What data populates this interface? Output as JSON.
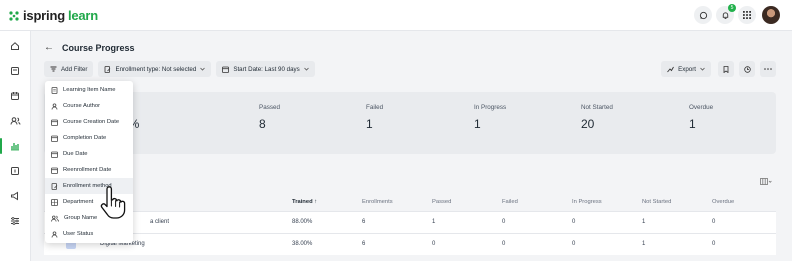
{
  "app": {
    "logo_word1": "ispring",
    "logo_word2": "learn",
    "notification_count": "5",
    "brand_color": "#20a84a"
  },
  "page": {
    "title": "Course Progress"
  },
  "toolbar": {
    "add_filter": "Add Filter",
    "enrollment_type": "Enrollment type: Not selected",
    "start_date": "Start Date: Last 90 days",
    "export": "Export"
  },
  "stats": [
    {
      "label": "ned",
      "value": "5%"
    },
    {
      "label": "Passed",
      "value": "8"
    },
    {
      "label": "Failed",
      "value": "1"
    },
    {
      "label": "In Progress",
      "value": "1"
    },
    {
      "label": "Not Started",
      "value": "20"
    },
    {
      "label": "Overdue",
      "value": "1"
    }
  ],
  "table": {
    "columns": [
      "Trained",
      "Enrollments",
      "Passed",
      "Failed",
      "In Progress",
      "Not Started",
      "Overdue"
    ],
    "rows": [
      {
        "name": "a client",
        "trained": "88.00%",
        "enrollments": "6",
        "passed": "1",
        "failed": "0",
        "in_progress": "0",
        "not_started": "1",
        "overdue": "0"
      },
      {
        "name": "Digital Marketing",
        "trained": "38.00%",
        "enrollments": "6",
        "passed": "0",
        "failed": "0",
        "in_progress": "0",
        "not_started": "1",
        "overdue": "0"
      }
    ]
  },
  "filter_menu": {
    "items": [
      {
        "label": "Learning Item Name",
        "icon": "file-icon"
      },
      {
        "label": "Course Author",
        "icon": "user-icon"
      },
      {
        "label": "Course Creation Date",
        "icon": "calendar-icon"
      },
      {
        "label": "Completion Date",
        "icon": "calendar-icon"
      },
      {
        "label": "Due Date",
        "icon": "calendar-icon"
      },
      {
        "label": "Reenrollment Date",
        "icon": "calendar-icon"
      },
      {
        "label": "Enrollment method",
        "icon": "file-edit-icon"
      },
      {
        "label": "Department",
        "icon": "department-icon"
      },
      {
        "label": "Group Name",
        "icon": "group-icon"
      },
      {
        "label": "User Status",
        "icon": "user-icon"
      }
    ]
  }
}
